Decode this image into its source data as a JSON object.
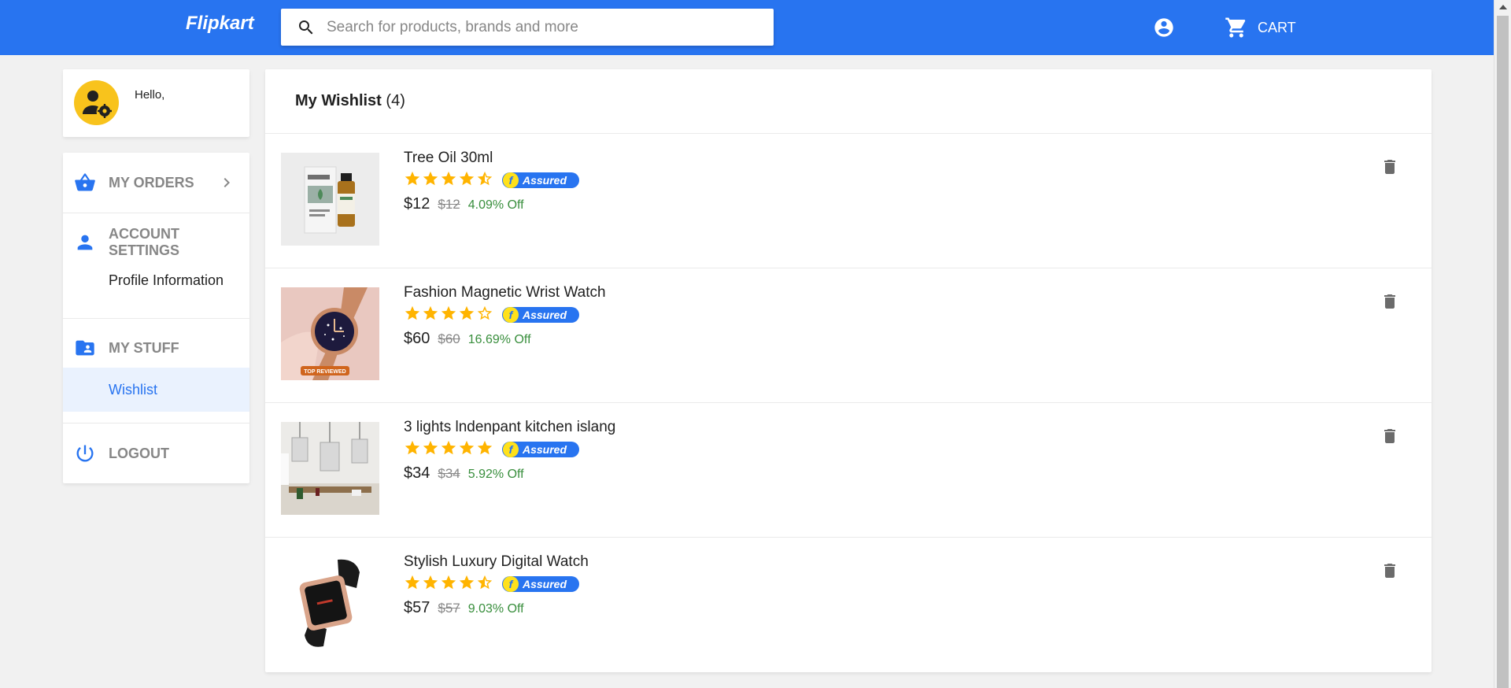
{
  "header": {
    "logo": "Flipkart",
    "search_placeholder": "Search for products, brands and more",
    "search_icon": "search-icon",
    "account_icon": "account-circle-icon",
    "cart_icon": "shopping-cart-icon",
    "cart_label": "CART"
  },
  "profile": {
    "greeting": "Hello,",
    "avatar_icon": "user-settings-icon"
  },
  "sidebar": {
    "my_orders": "MY ORDERS",
    "account_settings": "ACCOUNT SETTINGS",
    "profile_information": "Profile Information",
    "my_stuff": "MY STUFF",
    "wishlist": "Wishlist",
    "logout": "LOGOUT"
  },
  "wishlist": {
    "title": "My Wishlist",
    "count": "(4)",
    "items": [
      {
        "name": "Tree Oil 30ml",
        "rating": 4.5,
        "assured": "Assured",
        "price": "$12",
        "original_price": "$12",
        "discount": "4.09% Off",
        "image": "tea-tree-oil-bottle"
      },
      {
        "name": "Fashion Magnetic Wrist Watch",
        "rating": 4,
        "assured": "Assured",
        "price": "$60",
        "original_price": "$60",
        "discount": "16.69% Off",
        "image": "magnetic-wrist-watch",
        "image_badge": "TOP REVIEWED"
      },
      {
        "name": "3 lights lndenpant kitchen islang",
        "rating": 5,
        "assured": "Assured",
        "price": "$34",
        "original_price": "$34",
        "discount": "5.92% Off",
        "image": "pendant-lights"
      },
      {
        "name": "Stylish Luxury Digital Watch",
        "rating": 4.5,
        "assured": "Assured",
        "price": "$57",
        "original_price": "$57",
        "discount": "9.03% Off",
        "image": "digital-watch"
      }
    ]
  },
  "colors": {
    "brand_blue": "#2874f0",
    "star_yellow": "#ffb400",
    "discount_green": "#388e3c",
    "avatar_yellow": "#f8c31c"
  }
}
